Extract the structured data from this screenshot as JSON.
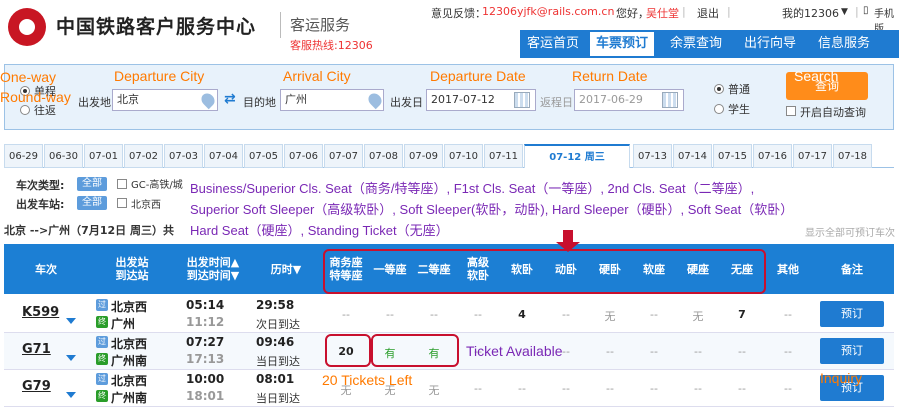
{
  "header": {
    "brand": "中国铁路客户服务中心",
    "subbrand": "客运服务",
    "hotline": "客服热线:12306",
    "feedback_label": "意见反馈：",
    "feedback_email": "12306yjfk@rails.com.cn",
    "greeting": "您好，",
    "user": "吴仕堂",
    "logout": "退出",
    "my12306": "我的12306",
    "mobile": "手机版"
  },
  "nav": [
    "客运首页",
    "车票预订",
    "余票查询",
    "出行向导",
    "信息服务"
  ],
  "search": {
    "one_way": "单程",
    "round_way": "往返",
    "from_label": "出发地",
    "from_value": "北京",
    "to_label": "目的地",
    "to_value": "广州",
    "date_label": "出发日",
    "date_value": "2017-07-12",
    "return_label": "返程日",
    "return_value": "2017-06-29",
    "type_normal": "普通",
    "type_student": "学生",
    "query_button": "查询",
    "auto_query": "开启自动查询"
  },
  "dates": [
    "06-29",
    "06-30",
    "07-01",
    "07-02",
    "07-03",
    "07-04",
    "07-05",
    "07-06",
    "07-07",
    "07-08",
    "07-09",
    "07-10",
    "07-11",
    "07-12 周三",
    "07-13",
    "07-14",
    "07-15",
    "07-16",
    "07-17",
    "07-18"
  ],
  "filters": {
    "type_label": "车次类型:",
    "station_label": "出发车站:",
    "all": "全部",
    "gc_option": "GC-高铁/城",
    "station_option": "北京西"
  },
  "result_info": "北京 -->广州（7月12日 周三）共",
  "display_all": "显示全部可预订车次",
  "table": {
    "headers": {
      "train": "车次",
      "station1": "出发站",
      "station2": "到达站",
      "time1": "出发时间▲",
      "time2": "到达时间▼",
      "duration": "历时▼",
      "swz1": "商务座",
      "swz2": "特等座",
      "first": "一等座",
      "second": "二等座",
      "gjrw1": "高级",
      "gjrw2": "软卧",
      "rw": "软卧",
      "dw": "动卧",
      "yw": "硬卧",
      "rz": "软座",
      "yz": "硬座",
      "wz": "无座",
      "other": "其他",
      "remark": "备注"
    },
    "rows": [
      {
        "train": "K599",
        "from": "北京西",
        "to": "广州",
        "dep": "05:14",
        "arr": "11:12",
        "dur": "29:58",
        "day": "次日到达",
        "seats": [
          "--",
          "--",
          "--",
          "--",
          "4",
          "--",
          "无",
          "--",
          "无",
          "7",
          "--"
        ],
        "book": "预订"
      },
      {
        "train": "G71",
        "from": "北京西",
        "to": "广州南",
        "dep": "07:27",
        "arr": "17:13",
        "dur": "09:46",
        "day": "当日到达",
        "seats": [
          "20",
          "有",
          "有",
          "--",
          "--",
          "--",
          "--",
          "--",
          "--",
          "--",
          "--"
        ],
        "book": "预订"
      },
      {
        "train": "G79",
        "from": "北京西",
        "to": "广州南",
        "dep": "10:00",
        "arr": "18:01",
        "dur": "08:01",
        "day": "当日到达",
        "seats": [
          "无",
          "无",
          "无",
          "--",
          "--",
          "--",
          "--",
          "--",
          "--",
          "--",
          "--"
        ],
        "book": "预订"
      }
    ]
  },
  "annotations": {
    "one_way": "One-way",
    "round_way": "Round-way",
    "departure_city": "Departure City",
    "arrival_city": "Arrival City",
    "departure_date": "Departure Date",
    "return_date": "Return Date",
    "search": "Search",
    "seat_line1": "Business/Superior Cls. Seat（商务/特等座）, F1st Cls. Seat（一等座）, 2nd Cls. Seat（二等座）,",
    "seat_line2": "Superior Soft Sleeper（高级软卧）, Soft Sleeper(软卧，动卧), Hard Sleeper（硬卧）, Soft Seat（软卧）",
    "seat_line3": "Hard Seat（硬座）, Standing Ticket（无座）",
    "ticket_available": "Ticket Available",
    "tickets_left": "20 Tickets Left",
    "inquiry": "Inquiry"
  },
  "colors": {
    "nav_blue": "#1f7bd1",
    "annotation_orange": "#ff7a00",
    "annotation_purple": "#7a28b5",
    "box_red": "#c8102e",
    "search_orange": "#ff8c1a"
  }
}
